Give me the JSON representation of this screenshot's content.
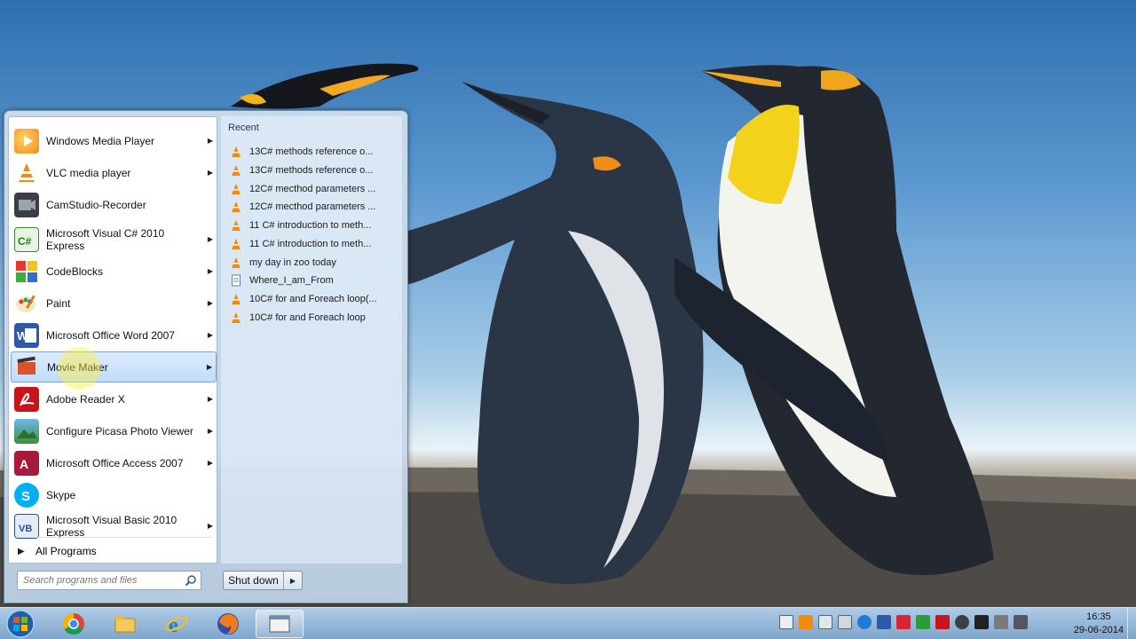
{
  "start_menu": {
    "programs": [
      {
        "label": "Windows Media Player",
        "has_arrow": true
      },
      {
        "label": "VLC media player",
        "has_arrow": true
      },
      {
        "label": "CamStudio-Recorder",
        "has_arrow": false
      },
      {
        "label": "Microsoft Visual C# 2010 Express",
        "has_arrow": true
      },
      {
        "label": "CodeBlocks",
        "has_arrow": true
      },
      {
        "label": "Paint",
        "has_arrow": true
      },
      {
        "label": "Microsoft Office Word 2007",
        "has_arrow": true
      },
      {
        "label": "Movie Maker",
        "has_arrow": true
      },
      {
        "label": "Adobe Reader X",
        "has_arrow": true
      },
      {
        "label": "Configure Picasa Photo Viewer",
        "has_arrow": true
      },
      {
        "label": "Microsoft Office Access 2007",
        "has_arrow": true
      },
      {
        "label": "Skype",
        "has_arrow": false
      },
      {
        "label": "Microsoft Visual Basic 2010 Express",
        "has_arrow": true
      }
    ],
    "all_programs_label": "All Programs",
    "search_placeholder": "Search programs and files",
    "recent_title": "Recent",
    "recent_items": [
      {
        "label": "13C# methods reference o...",
        "icon": "vlc-icon"
      },
      {
        "label": "13C# methods reference o...",
        "icon": "vlc-icon"
      },
      {
        "label": "12C# mecthod parameters ...",
        "icon": "vlc-icon"
      },
      {
        "label": "12C# mecthod parameters ...",
        "icon": "vlc-icon"
      },
      {
        "label": "11 C# introduction to meth...",
        "icon": "vlc-icon"
      },
      {
        "label": "11 C# introduction to meth...",
        "icon": "vlc-icon"
      },
      {
        "label": "my day in zoo today",
        "icon": "vlc-icon"
      },
      {
        "label": "Where_I_am_From",
        "icon": "document-icon"
      },
      {
        "label": "10C# for and Foreach loop(...",
        "icon": "vlc-icon"
      },
      {
        "label": "10C# for and Foreach loop",
        "icon": "vlc-icon"
      }
    ],
    "shutdown_label": "Shut down"
  },
  "taskbar": {
    "pinned": [
      "chrome-icon",
      "file-explorer-icon",
      "internet-explorer-icon",
      "firefox-icon",
      "window-icon"
    ],
    "clock_time": "16:35",
    "clock_date": "29-06-2014"
  },
  "colors": {
    "hover_bg": "#c1dcfc",
    "menu_border": "#6f879e",
    "taskbar": "#89afd3"
  }
}
